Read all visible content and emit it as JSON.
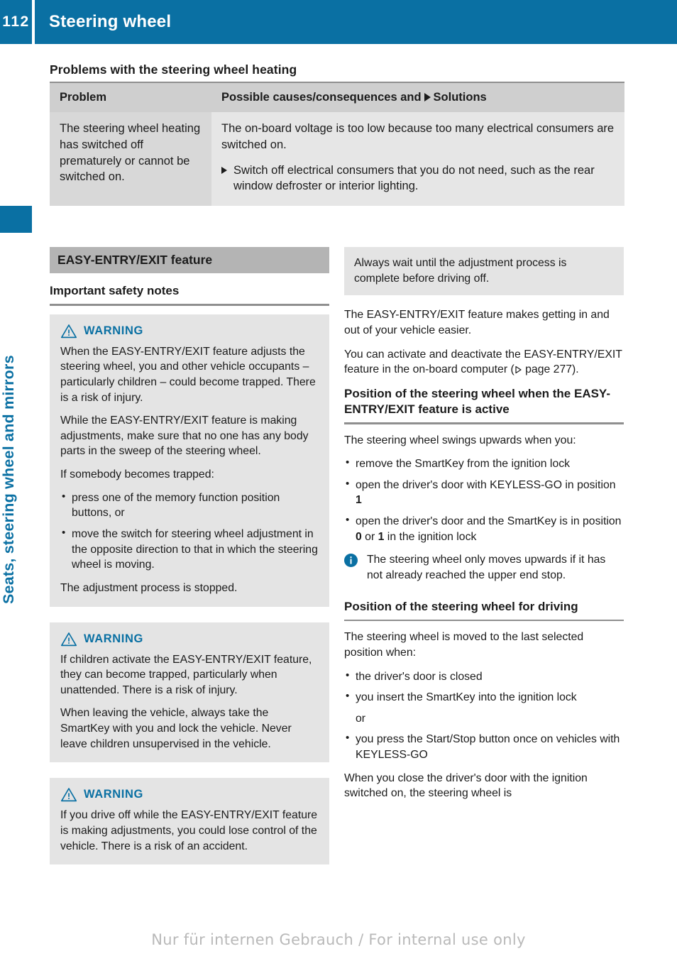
{
  "header": {
    "page_number": "112",
    "title": "Steering wheel"
  },
  "sidebar": {
    "chapter_label": "Seats, steering wheel and mirrors",
    "accent_color": "#0a70a3"
  },
  "main": {
    "section_title": "Problems with the steering wheel heating",
    "table": {
      "headers": {
        "problem": "Problem",
        "solutions_prefix": "Possible causes/consequences and",
        "solutions_suffix": "Solutions"
      },
      "rows": [
        {
          "problem": "The steering wheel heating has switched off prematurely or cannot be switched on.",
          "cause": "The on-board voltage is too low because too many electrical consumers are switched on.",
          "solution": "Switch off electrical consumers that you do not need, such as the rear window defroster or interior lighting."
        }
      ]
    }
  },
  "left_column": {
    "band_title": "EASY-ENTRY/EXIT feature",
    "sub_head": "Important safety notes",
    "warnings": [
      {
        "label": "WARNING",
        "paragraphs": [
          "When the EASY-ENTRY/EXIT feature adjusts the steering wheel, you and other vehicle occupants – particularly children – could become trapped. There is a risk of injury.",
          "While the EASY-ENTRY/EXIT feature is making adjustments, make sure that no one has any body parts in the sweep of the steering wheel.",
          "If somebody becomes trapped:"
        ],
        "bullets": [
          "press one of the memory function position buttons, or",
          "move the switch for steering wheel adjustment in the opposite direction to that in which the steering wheel is moving."
        ],
        "closing": "The adjustment process is stopped."
      },
      {
        "label": "WARNING",
        "paragraphs": [
          "If children activate the EASY-ENTRY/EXIT feature, they can become trapped, particularly when unattended. There is a risk of injury.",
          "When leaving the vehicle, always take the SmartKey with you and lock the vehicle. Never leave children unsupervised in the vehicle."
        ],
        "bullets": [],
        "closing": ""
      },
      {
        "label": "WARNING",
        "paragraphs": [
          "If you drive off while the EASY-ENTRY/EXIT feature is making adjustments, you could lose control of the vehicle. There is a risk of an accident."
        ],
        "bullets": [],
        "closing": ""
      }
    ]
  },
  "right_column": {
    "continued_note": "Always wait until the adjustment process is complete before driving off.",
    "intro_paragraph": "The EASY-ENTRY/EXIT feature makes getting in and out of your vehicle easier.",
    "activate_paragraph_pre": "You can activate and deactivate the EASY-ENTRY/EXIT feature in the on-board computer (",
    "activate_paragraph_page": " page 277).",
    "section_active": {
      "heading": "Position of the steering wheel when the EASY-ENTRY/EXIT feature is active",
      "lead": "The steering wheel swings upwards when you:",
      "bullets": [
        {
          "pre": "remove the SmartKey from the ignition lock",
          "bold": "",
          "post": ""
        },
        {
          "pre": "open the driver's door with KEYLESS-GO in position ",
          "bold": "1",
          "post": ""
        },
        {
          "pre": "open the driver's door and the SmartKey is in position ",
          "bold": "0",
          "post": " or ",
          "bold2": "1",
          "post2": " in the ignition lock"
        }
      ]
    },
    "info_note": "The steering wheel only moves upwards if it has not already reached the upper end stop.",
    "section_driving": {
      "heading": "Position of the steering wheel for driving",
      "lead": "The steering wheel is moved to the last selected position when:",
      "bullets": [
        "the driver's door is closed",
        "you insert the SmartKey into the ignition lock",
        "you press the Start/Stop button once on vehicles with KEYLESS-GO"
      ],
      "or_word": "or",
      "closing": "When you close the driver's door with the ignition switched on, the steering wheel is"
    }
  },
  "footer": {
    "watermark": "Nur für internen Gebrauch / For internal use only"
  }
}
